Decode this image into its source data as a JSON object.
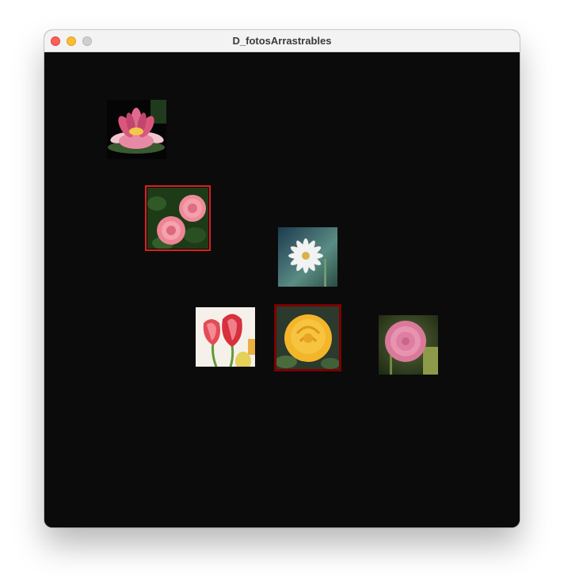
{
  "window": {
    "title": "D_fotosArrastrables"
  },
  "canvas": {
    "background": "#0b0b0b"
  },
  "photos": [
    {
      "name": "lotus",
      "selected": false
    },
    {
      "name": "pink-dahlias",
      "selected": true,
      "border_color": "#e01e1e"
    },
    {
      "name": "daisy",
      "selected": false
    },
    {
      "name": "tulips",
      "selected": false
    },
    {
      "name": "yellow-rose",
      "selected": true,
      "border_color": "#7a0000"
    },
    {
      "name": "pink-dahlia",
      "selected": false
    }
  ]
}
